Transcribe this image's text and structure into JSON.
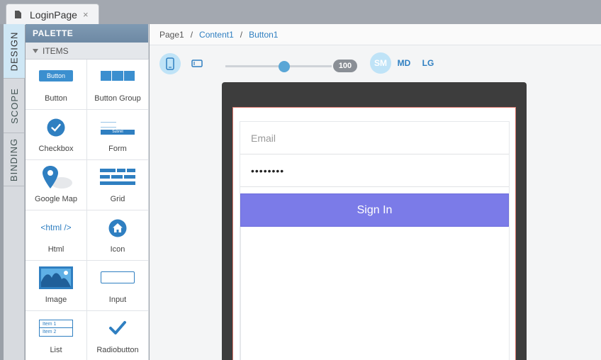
{
  "tab": {
    "title": "LoginPage",
    "close": "×"
  },
  "vtabs": [
    "DESIGN",
    "SCOPE",
    "BINDING"
  ],
  "palette": {
    "header": "PALETTE",
    "section": "ITEMS",
    "items": [
      {
        "label": "Button",
        "icon": "button-icon",
        "preview": "Button"
      },
      {
        "label": "Button Group",
        "icon": "button-group-icon"
      },
      {
        "label": "Checkbox",
        "icon": "checkbox-icon"
      },
      {
        "label": "Form",
        "icon": "form-icon",
        "preview": "Submit"
      },
      {
        "label": "Google Map",
        "icon": "map-pin-icon"
      },
      {
        "label": "Grid",
        "icon": "grid-icon"
      },
      {
        "label": "Html",
        "icon": "html-icon",
        "preview": "<html />"
      },
      {
        "label": "Icon",
        "icon": "home-icon"
      },
      {
        "label": "Image",
        "icon": "image-icon"
      },
      {
        "label": "Input",
        "icon": "input-icon"
      },
      {
        "label": "List",
        "icon": "list-icon",
        "preview": [
          "Item 1",
          "Item 2"
        ]
      },
      {
        "label": "Radiobutton",
        "icon": "checkmark-icon"
      }
    ]
  },
  "breadcrumb": {
    "items": [
      "Page1",
      "Content1",
      "Button1"
    ],
    "separator": "/"
  },
  "toolbar": {
    "zoom": "100",
    "zoom_level": 0.55,
    "breakpoints": [
      "SM",
      "MD",
      "LG"
    ]
  },
  "form": {
    "email_placeholder": "Email",
    "password_value": "••••••••",
    "signin_label": "Sign In"
  },
  "colors": {
    "accent": "#2f7fc1",
    "button": "#7b7be8",
    "selection": "#e07a6f"
  }
}
